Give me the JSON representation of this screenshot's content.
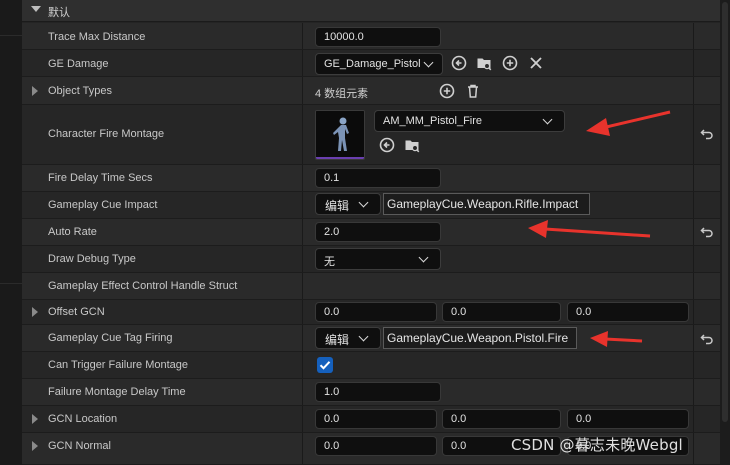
{
  "section": {
    "title": "默认"
  },
  "rows": {
    "trace_max_distance": {
      "label": "Trace Max Distance",
      "value": "10000.0"
    },
    "ge_damage": {
      "label": "GE Damage",
      "value": "GE_Damage_Pistol"
    },
    "object_types": {
      "label": "Object Types",
      "value": "4 数组元素"
    },
    "character_fire_montage": {
      "label": "Character Fire Montage",
      "value": "AM_MM_Pistol_Fire"
    },
    "fire_delay_time_secs": {
      "label": "Fire Delay Time Secs",
      "value": "0.1"
    },
    "gameplay_cue_impact": {
      "label": "Gameplay Cue Impact",
      "edit": "编辑",
      "tag": "GameplayCue.Weapon.Rifle.Impact"
    },
    "auto_rate": {
      "label": "Auto Rate",
      "value": "2.0"
    },
    "draw_debug_type": {
      "label": "Draw Debug Type",
      "value": "无"
    },
    "gameplay_effect_control_handle_struct": {
      "label": "Gameplay Effect Control Handle Struct"
    },
    "offset_gcn": {
      "label": "Offset GCN",
      "x": "0.0",
      "y": "0.0",
      "z": "0.0"
    },
    "gameplay_cue_tag_firing": {
      "label": "Gameplay Cue Tag Firing",
      "edit": "编辑",
      "tag": "GameplayCue.Weapon.Pistol.Fire"
    },
    "can_trigger_failure_montage": {
      "label": "Can Trigger Failure Montage",
      "checked": true
    },
    "failure_montage_delay_time": {
      "label": "Failure Montage Delay Time",
      "value": "1.0"
    },
    "gcn_location": {
      "label": "GCN Location",
      "x": "0.0",
      "y": "0.0",
      "z": "0.0"
    },
    "gcn_normal": {
      "label": "GCN Normal",
      "x": "0.0",
      "y": "0.0",
      "z": "0.0"
    }
  },
  "icons": {
    "browse": "arrow-left-circle-icon",
    "find": "folder-search-icon",
    "add": "plus-circle-icon",
    "clear": "x-icon",
    "delete": "trash-icon",
    "reset": "reset-arrow-icon",
    "expand": "chevron-right-icon",
    "dropdown": "chevron-down-icon"
  },
  "colors": {
    "annotation": "#e8332c",
    "checkbox": "#1560bd"
  },
  "watermark": "CSDN @暮志未晚Webgl"
}
